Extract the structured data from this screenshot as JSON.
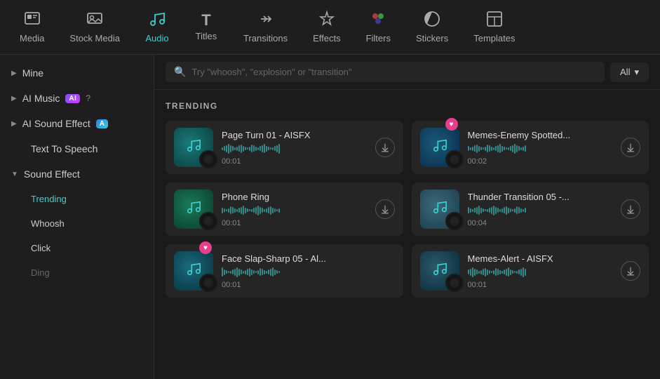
{
  "nav": {
    "items": [
      {
        "id": "media",
        "icon": "🎬",
        "label": "Media",
        "active": false
      },
      {
        "id": "stock-media",
        "icon": "📷",
        "label": "Stock Media",
        "active": false
      },
      {
        "id": "audio",
        "icon": "🎵",
        "label": "Audio",
        "active": true
      },
      {
        "id": "titles",
        "icon": "T",
        "label": "Titles",
        "active": false
      },
      {
        "id": "transitions",
        "icon": "↔",
        "label": "Transitions",
        "active": false
      },
      {
        "id": "effects",
        "icon": "✨",
        "label": "Effects",
        "active": false
      },
      {
        "id": "filters",
        "icon": "🔵",
        "label": "Filters",
        "active": false
      },
      {
        "id": "stickers",
        "icon": "😊",
        "label": "Stickers",
        "active": false
      },
      {
        "id": "templates",
        "icon": "⊞",
        "label": "Templates",
        "active": false
      }
    ]
  },
  "sidebar": {
    "sections": [
      {
        "id": "mine",
        "label": "Mine",
        "collapsed": true,
        "arrow": "▶",
        "badge": null,
        "help": false
      },
      {
        "id": "ai-music",
        "label": "AI Music",
        "collapsed": true,
        "arrow": "▶",
        "badge": "AI",
        "badge_type": "purple",
        "help": true
      },
      {
        "id": "ai-sound-effect",
        "label": "AI Sound Effect",
        "collapsed": true,
        "arrow": "▶",
        "badge": "A",
        "badge_type": "blue",
        "help": false
      },
      {
        "id": "text-to-speech",
        "label": "Text To Speech",
        "collapsed": false,
        "arrow": null,
        "badge": null,
        "help": false,
        "standalone": true
      },
      {
        "id": "sound-effect",
        "label": "Sound Effect",
        "collapsed": false,
        "arrow": "▼",
        "badge": null,
        "help": false
      }
    ],
    "sub_items": [
      {
        "id": "trending",
        "label": "Trending",
        "active": true,
        "parent": "sound-effect"
      },
      {
        "id": "whoosh",
        "label": "Whoosh",
        "active": false,
        "parent": "sound-effect"
      },
      {
        "id": "click",
        "label": "Click",
        "active": false,
        "parent": "sound-effect"
      },
      {
        "id": "ding",
        "label": "Ding",
        "active": false,
        "parent": "sound-effect"
      }
    ]
  },
  "search": {
    "placeholder": "Try \"whoosh\", \"explosion\" or \"transition\"",
    "filter_label": "All"
  },
  "trending": {
    "section_title": "TRENDING",
    "sounds": [
      {
        "id": "page-turn-01",
        "name": "Page Turn 01 - AISFX",
        "duration": "00:01",
        "favorite": false,
        "download": true
      },
      {
        "id": "memes-enemy",
        "name": "Memes-Enemy Spotted...",
        "duration": "00:02",
        "favorite": true,
        "download": true
      },
      {
        "id": "phone-ring",
        "name": "Phone Ring",
        "duration": "00:01",
        "favorite": false,
        "download": true
      },
      {
        "id": "thunder-transition",
        "name": "Thunder Transition 05 -...",
        "duration": "00:04",
        "favorite": false,
        "download": true
      },
      {
        "id": "face-slap",
        "name": "Face Slap-Sharp 05 - Al...",
        "duration": "00:01",
        "favorite": true,
        "download": false
      },
      {
        "id": "memes-alert",
        "name": "Memes-Alert - AISFX",
        "duration": "00:01",
        "favorite": false,
        "download": true
      }
    ]
  },
  "icons": {
    "search": "🔍",
    "download": "⬇",
    "chevron_down": "▾",
    "heart": "♥",
    "music_note": "♪"
  }
}
